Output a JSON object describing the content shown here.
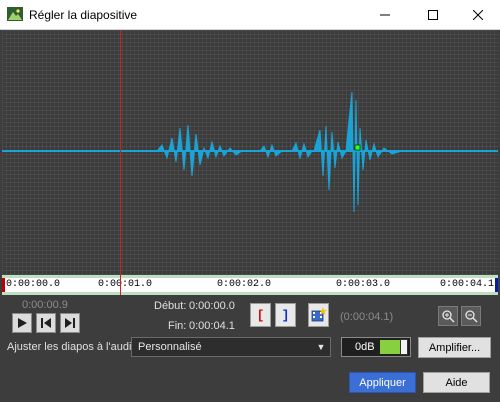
{
  "window": {
    "title": "Régler la diapositive",
    "minimize_icon": "minimize-icon",
    "maximize_icon": "maximize-icon",
    "close_icon": "close-icon"
  },
  "colors": {
    "waveform": "#1aa3d6",
    "cursor": "#d02020",
    "primary_button": "#3b6fd6",
    "db_level": "#88d040"
  },
  "timeline": {
    "ticks": [
      "0:00:00.0",
      "0:00:01.0",
      "0:00:02.0",
      "0:00:03.0",
      "0:00:04.1"
    ]
  },
  "playback": {
    "current_time": "0:00:00.9",
    "icons": [
      "play-icon",
      "skip-start-icon",
      "skip-end-icon"
    ]
  },
  "range": {
    "start_label": "Début:",
    "start_value": "0:00:00.0",
    "end_label": "Fin:",
    "end_value": "0:00:04.1",
    "duration": "(0:00:04.1)",
    "mark_start_glyph": "[",
    "mark_end_glyph": "]"
  },
  "audio": {
    "adjust_label": "Ajuster les diapos à l'audio:",
    "mode_selected": "Personnalisé",
    "gain": "0dB",
    "amplify_label": "Amplifier..."
  },
  "footer": {
    "apply_label": "Appliquer",
    "help_label": "Aide"
  }
}
